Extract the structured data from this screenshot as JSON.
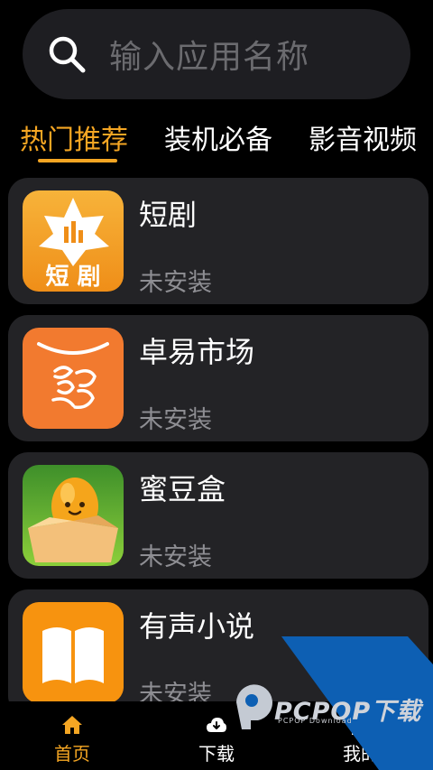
{
  "search": {
    "placeholder": "输入应用名称",
    "icon": "search-icon"
  },
  "tabs": [
    {
      "label": "热门推荐",
      "active": true
    },
    {
      "label": "装机必备",
      "active": false
    },
    {
      "label": "影音视频",
      "active": false
    }
  ],
  "apps": [
    {
      "name": "短剧",
      "status": "未安装",
      "icon": "short-drama-app-icon",
      "icon_text": "短 剧"
    },
    {
      "name": "卓易市场",
      "status": "未安装",
      "icon": "zhuoyi-market-app-icon"
    },
    {
      "name": "蜜豆盒",
      "status": "未安装",
      "icon": "midouhe-app-icon"
    },
    {
      "name": "有声小说",
      "status": "未安装",
      "icon": "audiobook-app-icon"
    }
  ],
  "bottom_nav": [
    {
      "label": "首页",
      "icon": "home-icon",
      "active": true
    },
    {
      "label": "下载",
      "icon": "download-cloud-icon",
      "active": false
    },
    {
      "label": "我的",
      "icon": "profile-icon",
      "active": false
    }
  ],
  "watermark": {
    "text": "PCPOP下载",
    "subtext": "PCPOP Download"
  },
  "colors": {
    "accent": "#f5a623",
    "background": "#000000",
    "card": "#232326",
    "muted": "#8e8e93"
  }
}
